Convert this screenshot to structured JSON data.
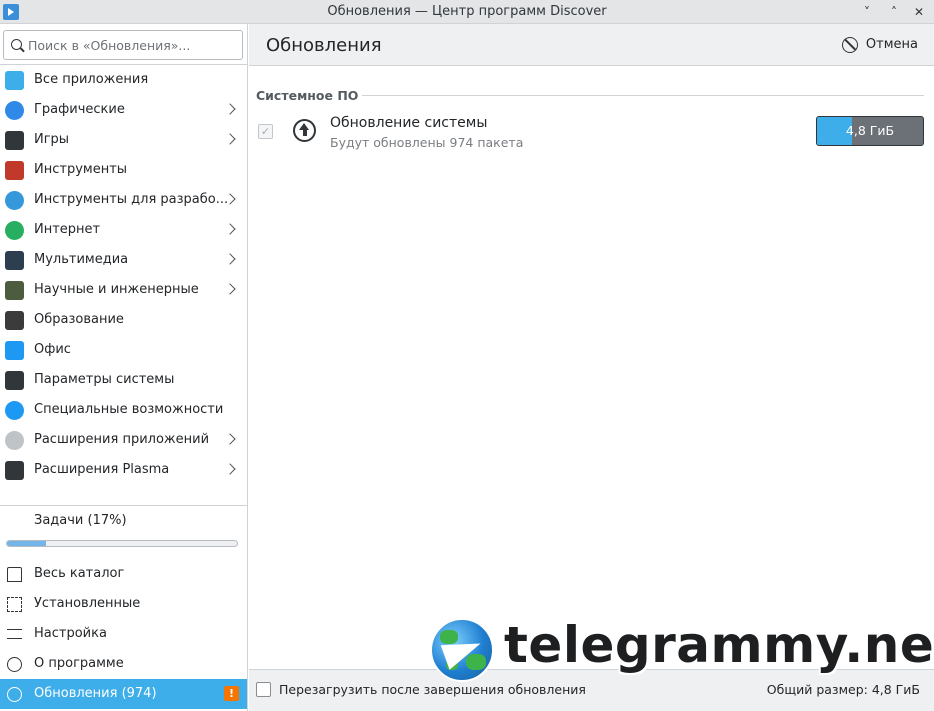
{
  "window": {
    "title": "Обновления — Центр программ Discover",
    "controls": [
      "˅",
      "˄",
      "✕"
    ]
  },
  "search": {
    "placeholder": "Поиск в «Обновления»..."
  },
  "sidebar": {
    "categories": [
      {
        "label": "Все приложения",
        "icon": "all-apps-icon",
        "color": "#3daee9",
        "has_children": false
      },
      {
        "label": "Графические",
        "icon": "graphics-icon",
        "color": "#2e8ae6",
        "has_children": true
      },
      {
        "label": "Игры",
        "icon": "gamepad-icon",
        "color": "#31363b",
        "has_children": true
      },
      {
        "label": "Инструменты",
        "icon": "toolbox-icon",
        "color": "#c0392b",
        "has_children": false
      },
      {
        "label": "Инструменты для разрабо...",
        "icon": "developer-tools-icon",
        "color": "#3498db",
        "has_children": true
      },
      {
        "label": "Интернет",
        "icon": "globe-icon",
        "color": "#27ae60",
        "has_children": true
      },
      {
        "label": "Мультимедиа",
        "icon": "multimedia-icon",
        "color": "#2c3e50",
        "has_children": true
      },
      {
        "label": "Научные и инженерные",
        "icon": "flask-icon",
        "color": "#4d5c3e",
        "has_children": true
      },
      {
        "label": "Образование",
        "icon": "blackboard-icon",
        "color": "#3b3b3b",
        "has_children": false
      },
      {
        "label": "Офис",
        "icon": "office-icon",
        "color": "#1d99f3",
        "has_children": false
      },
      {
        "label": "Параметры системы",
        "icon": "system-settings-icon",
        "color": "#31363b",
        "has_children": false
      },
      {
        "label": "Специальные возможности",
        "icon": "accessibility-icon",
        "color": "#1d99f3",
        "has_children": false
      },
      {
        "label": "Расширения приложений",
        "icon": "app-extensions-icon",
        "color": "#bdc3c7",
        "has_children": true
      },
      {
        "label": "Расширения Plasma",
        "icon": "plasma-icon",
        "color": "#31363b",
        "has_children": true
      }
    ],
    "tasks": {
      "label": "Задачи (17%)",
      "progress": 0.17
    },
    "nav": [
      {
        "label": "Весь каталог",
        "icon": "home-icon",
        "active": false
      },
      {
        "label": "Установленные",
        "icon": "installed-icon",
        "active": false
      },
      {
        "label": "Настройка",
        "icon": "settings-icon",
        "active": false
      },
      {
        "label": "О программе",
        "icon": "info-icon",
        "active": false
      },
      {
        "label": "Обновления (974)",
        "icon": "updates-icon",
        "active": true,
        "badge": "!"
      }
    ]
  },
  "header": {
    "title": "Обновления",
    "cancel_label": "Отмена"
  },
  "main": {
    "section_title": "Системное ПО",
    "updates": [
      {
        "name": "Обновление системы",
        "description": "Будут обновлены 974 пакета",
        "size": "4,8 ГиБ",
        "progress": 0.33,
        "checked": true
      }
    ]
  },
  "footer": {
    "restart_label": "Перезагрузить после завершения обновления",
    "restart_checked": false,
    "total_size": "Общий размер: 4,8 ГиБ"
  },
  "watermark": {
    "text": "telegrammy.net"
  },
  "colors": {
    "accent": "#3daee9",
    "warning": "#f67400"
  }
}
